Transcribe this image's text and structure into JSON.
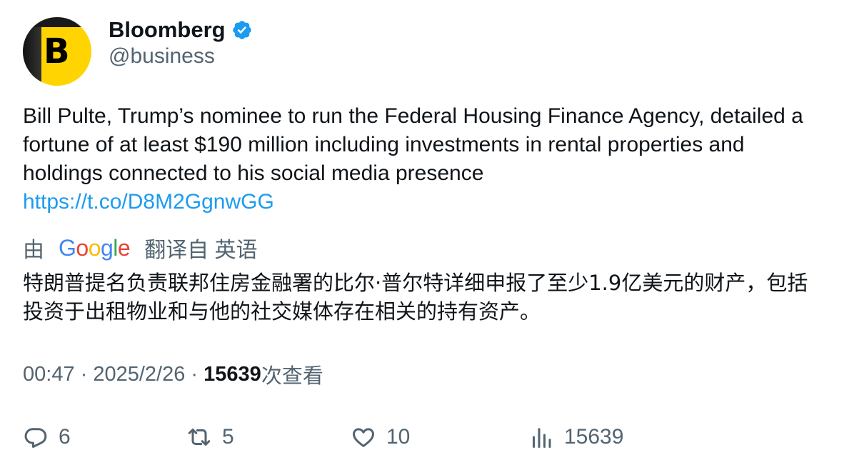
{
  "account": {
    "display_name": "Bloomberg",
    "handle": "@business",
    "avatar_letter": "B",
    "verified": true,
    "avatar_color": "#ffd400",
    "verified_color": "#1d9bf0"
  },
  "tweet": {
    "text": "Bill Pulte, Trump’s nominee to run the Federal Housing Finance Agency, detailed a fortune of at least $190 million including investments in rental properties and holdings connected to his social media presence",
    "link": "https://t.co/D8M2GgnwGG",
    "link_color": "#1d9bf0"
  },
  "translation": {
    "prefix": "由",
    "provider": "Google",
    "suffix": "翻译自 英语",
    "text": "特朗普提名负责联邦住房金融署的比尔·普尔特详细申报了至少1.9亿美元的财产，包括投资于出租物业和与他的社交媒体存在相关的持有资产。"
  },
  "meta": {
    "time": "00:47",
    "separator": " · ",
    "date": "2025/2/26",
    "views_count": "15639",
    "views_label": "次查看"
  },
  "actions": {
    "reply_count": "6",
    "retweet_count": "5",
    "like_count": "10",
    "views_count": "15639"
  },
  "icons": {
    "reply": "reply-icon",
    "retweet": "retweet-icon",
    "like": "heart-icon",
    "views": "analytics-icon",
    "verified": "verified-badge-icon"
  }
}
